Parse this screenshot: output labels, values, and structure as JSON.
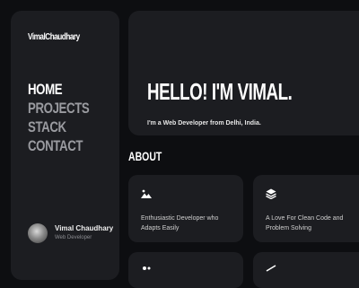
{
  "sidebar": {
    "brand": "VimalChaudhary",
    "nav": [
      {
        "label": "HOME",
        "active": true
      },
      {
        "label": "PROJECTS",
        "active": false
      },
      {
        "label": "STACK",
        "active": false
      },
      {
        "label": "CONTACT",
        "active": false
      }
    ],
    "profile": {
      "name": "Vimal Chaudhary",
      "role": "Web Developer"
    }
  },
  "hero": {
    "title": "HELLO! I'M VIMAL.",
    "subtitle": "I'm a Web Developer from Delhi, India."
  },
  "about": {
    "heading": "ABOUT",
    "cards": [
      {
        "icon": "mountain-image-icon",
        "text": "Enthusiastic Developer who Adapts Easily"
      },
      {
        "icon": "layers-stack-icon",
        "text": "A Love For Clean Code and Problem Solving"
      },
      {
        "icon": "partial-icon",
        "text": ""
      },
      {
        "icon": "partial-icon",
        "text": ""
      }
    ]
  },
  "colors": {
    "background": "#0d0e11",
    "panel": "#1c1d21",
    "text": "#ffffff",
    "muted": "#9a9ba0"
  }
}
